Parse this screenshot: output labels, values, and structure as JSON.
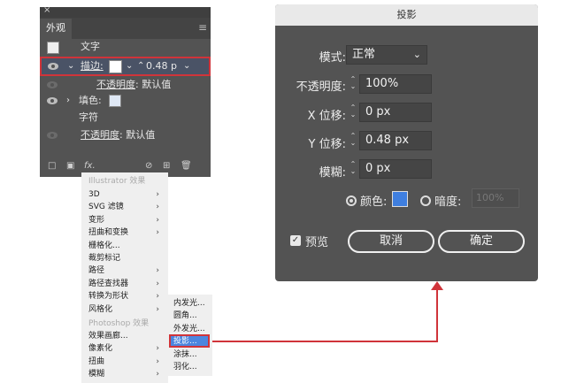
{
  "appearance_panel": {
    "close_glyph": "×",
    "tab_label": "外观",
    "menu_glyph": "≡",
    "text_label": "文字",
    "stroke_label": "描边:",
    "stroke_value": "0.48 p",
    "stroke_opacity_label": "不透明度",
    "stroke_opacity_value": ": 默认值",
    "fill_label": "填色:",
    "char_label": "字符",
    "opacity_label": "不透明度",
    "opacity_value": ": 默认值",
    "fx_label": "fx."
  },
  "fx_menu": {
    "header_illustrator": "Illustrator 效果",
    "items_illustrator": [
      {
        "label": "3D",
        "arrow": "›"
      },
      {
        "label": "SVG 滤镜",
        "arrow": "›"
      },
      {
        "label": "变形",
        "arrow": "›"
      },
      {
        "label": "扭曲和变换",
        "arrow": "›"
      },
      {
        "label": "栅格化...",
        "arrow": ""
      },
      {
        "label": "裁剪标记",
        "arrow": ""
      },
      {
        "label": "路径",
        "arrow": "›"
      },
      {
        "label": "路径查找器",
        "arrow": "›"
      },
      {
        "label": "转换为形状",
        "arrow": "›"
      },
      {
        "label": "风格化",
        "arrow": "›"
      }
    ],
    "header_photoshop": "Photoshop 效果",
    "items_photoshop": [
      {
        "label": "效果画廊...",
        "arrow": ""
      },
      {
        "label": "像素化",
        "arrow": "›"
      },
      {
        "label": "扭曲",
        "arrow": "›"
      },
      {
        "label": "模糊",
        "arrow": "›"
      }
    ]
  },
  "stylize_submenu": {
    "items": [
      "内发光...",
      "圆角...",
      "外发光...",
      "投影...",
      "涂抹...",
      "羽化..."
    ]
  },
  "drop_shadow_dialog": {
    "title": "投影",
    "mode_label": "模式:",
    "mode_value": "正常",
    "opacity_label": "不透明度:",
    "opacity_value": "100%",
    "x_offset_label": "X 位移:",
    "x_offset_value": "0 px",
    "y_offset_label": "Y 位移:",
    "y_offset_value": "0.48 px",
    "blur_label": "模糊:",
    "blur_value": "0 px",
    "color_label": "颜色:",
    "color_swatch": "#3f7fe0",
    "darkness_label": "暗度:",
    "darkness_value": "100%",
    "preview_label": "预览",
    "cancel_label": "取消",
    "ok_label": "确定"
  },
  "colors": {
    "highlight": "#d0343a",
    "accent_blue": "#3f7fe0"
  }
}
